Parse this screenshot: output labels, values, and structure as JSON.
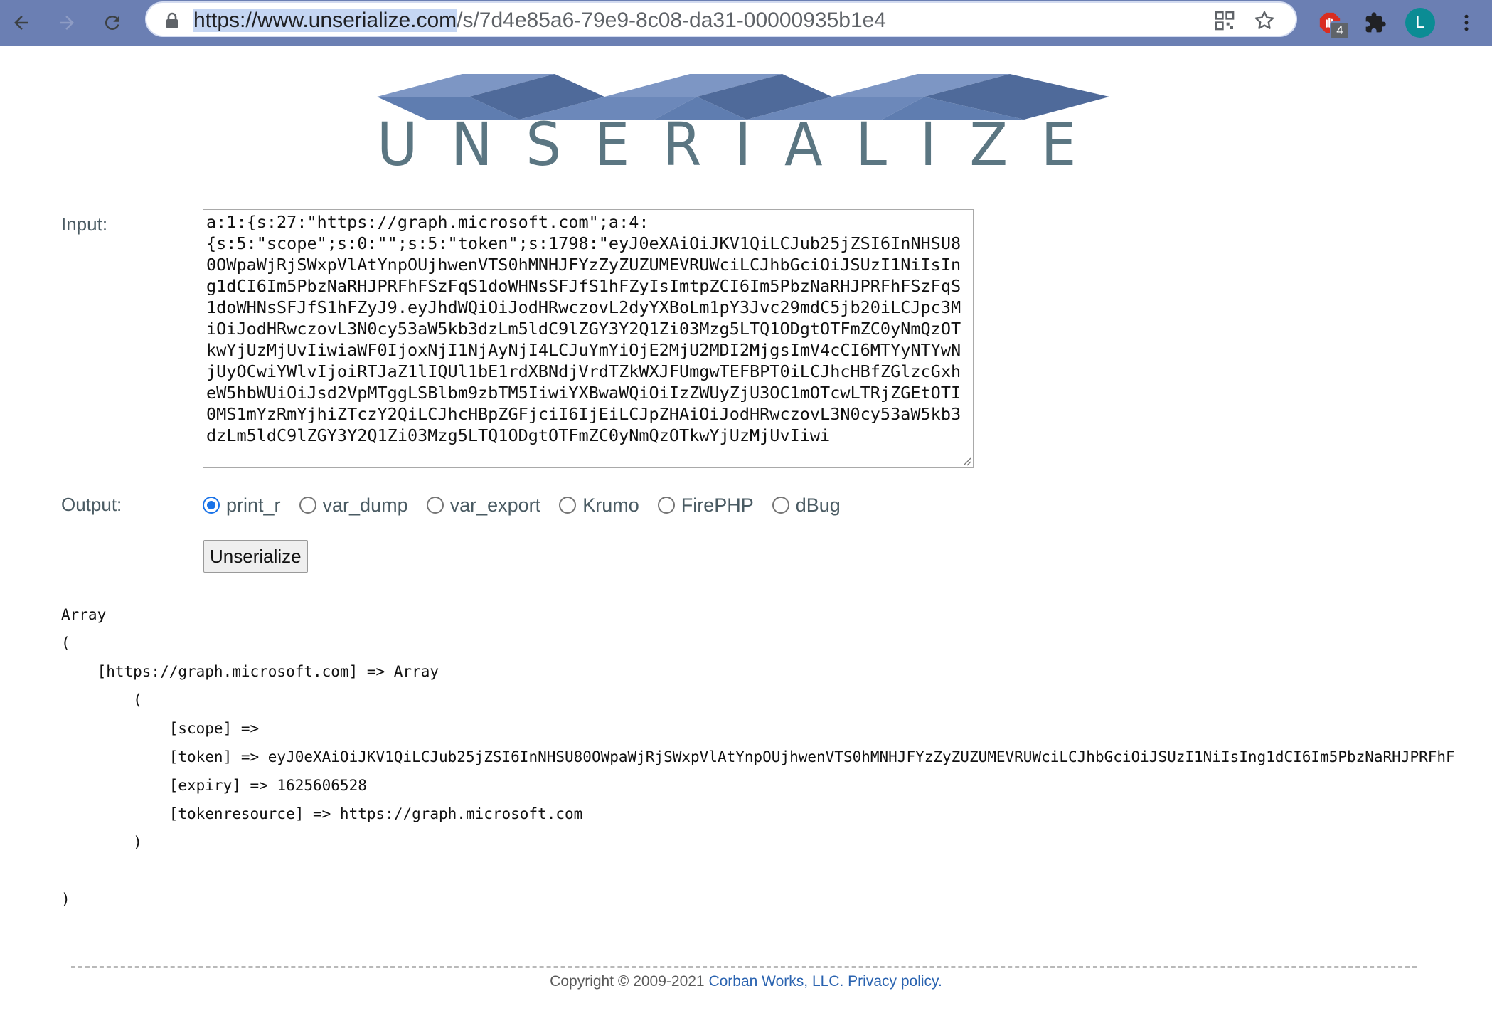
{
  "browser": {
    "url_origin": "https://www.unserialize.com",
    "url_path": "/s/7d4e85a6-79e9-8c08-da31-00000935b1e4",
    "extension_badge": "4",
    "profile_initial": "L"
  },
  "logo": {
    "text": "UNSERIALIZE"
  },
  "form": {
    "input_label": "Input:",
    "input_value": "a:1:{s:27:\"https://graph.microsoft.com\";a:4:\n{s:5:\"scope\";s:0:\"\";s:5:\"token\";s:1798:\"eyJ0eXAiOiJKV1QiLCJub25jZSI6InNHSU80OWpaWjRjSWxpVlAtYnpOUjhwenVTS0hMNHJFYzZyZUZUMEVRUWciLCJhbGciOiJSUzI1NiIsIng1dCI6Im5PbzNaRHJPRFhFSzFqS1doWHNsSFJfS1hFZyIsImtpZCI6Im5PbzNaRHJPRFhFSzFqS1doWHNsSFJfS1hFZyJ9.eyJhdWQiOiJodHRwczovL2dyYXBoLm1pY3Jvc29mdC5jb20iLCJpc3MiOiJodHRwczovL3N0cy53aW5kb3dzLm5ldC9lZGY3Y2Q1Zi03Mzg5LTQ1ODgtOTFmZC0yNmQzOTkwYjUzMjUvIiwiaWF0IjoxNjI1NjAyNjI4LCJuYmYiOjE2MjU2MDI2MjgsImV4cCI6MTYyNTYwNjUyOCwiYWlvIjoiRTJaZ1lIQUl1bE1rdXBNdjVrdTZkWXJFUmgwTEFBPT0iLCJhcHBfZGlzcGxheW5hbWUiOiJsd2VpMTggLSBlbm9zbTM5IiwiYXBwaWQiOiIzZWUyZjU3OC1mOTcwLTRjZGEtOTI0MS1mYzRmYjhiZTczY2QiLCJhcHBpZGFjciI6IjEiLCJpZHAiOiJodHRwczovL3N0cy53aW5kb3dzLm5ldC9lZGY3Y2Q1Zi03Mzg5LTQ1ODgtOTFmZC0yNmQzOTkwYjUzMjUvIiwi",
    "output_label": "Output:",
    "output_options": [
      {
        "label": "print_r",
        "selected": true
      },
      {
        "label": "var_dump",
        "selected": false
      },
      {
        "label": "var_export",
        "selected": false
      },
      {
        "label": "Krumo",
        "selected": false
      },
      {
        "label": "FirePHP",
        "selected": false
      },
      {
        "label": "dBug",
        "selected": false
      }
    ],
    "submit_label": "Unserialize"
  },
  "output": {
    "lines": [
      "Array",
      "(",
      "    [https://graph.microsoft.com] => Array",
      "        (",
      "            [scope] =>",
      "            [token] => eyJ0eXAiOiJKV1QiLCJub25jZSI6InNHSU80OWpaWjRjSWxpVlAtYnpOUjhwenVTS0hMNHJFYzZyZUZUMEVRUWciLCJhbGciOiJSUzI1NiIsIng1dCI6Im5PbzNaRHJPRFhF",
      "            [expiry] => 1625606528",
      "            [tokenresource] => https://graph.microsoft.com",
      "        )",
      "",
      ")"
    ]
  },
  "footer": {
    "copyright": "Copyright © 2009-2021 ",
    "company_link": "Corban Works, LLC.",
    "privacy_link": "Privacy policy."
  },
  "colors": {
    "chrome_bar": "#6b7fb3",
    "logo_dark": "#4f6a9a",
    "logo_light": "#7d96c4",
    "logo_text": "#5b7682",
    "radio_selected": "#1a73e8",
    "link": "#2a63b0"
  }
}
